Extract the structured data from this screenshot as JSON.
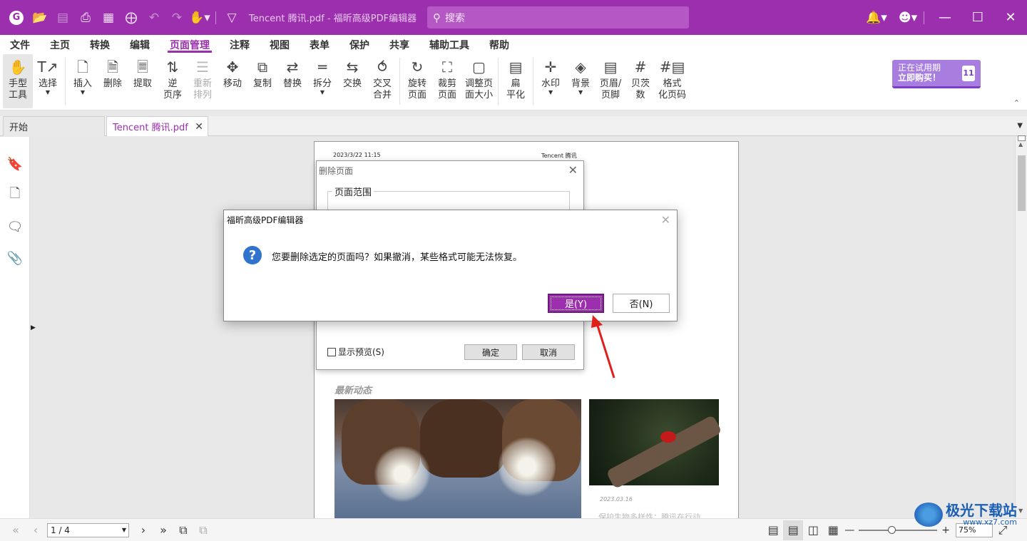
{
  "app": {
    "title": "Tencent 腾讯.pdf - 福昕高级PDF编辑器",
    "search_placeholder": "搜索",
    "accent_color": "#9b2fae"
  },
  "titlebar_icons": [
    "app-logo",
    "open-folder-icon",
    "save-icon",
    "print-icon",
    "export-icon",
    "new-file-icon",
    "undo-icon",
    "redo-icon",
    "hand-dropdown-icon",
    "customize-dropdown-icon"
  ],
  "menu": {
    "items": [
      "文件",
      "主页",
      "转换",
      "编辑",
      "页面管理",
      "注释",
      "视图",
      "表单",
      "保护",
      "共享",
      "辅助工具",
      "帮助"
    ],
    "active": "页面管理"
  },
  "ribbon": {
    "hand": "手型\n工具",
    "select": "选择",
    "insert": "插入",
    "delete": "删除",
    "extract": "提取",
    "reverse": "逆\n页序",
    "reorder": "重新\n排列",
    "move": "移动",
    "copy": "复制",
    "replace": "替换",
    "split": "拆分",
    "swap": "交换",
    "interleave": "交叉\n合并",
    "rotate": "旋转\n页面",
    "crop": "裁剪\n页面",
    "resize": "调整页\n面大小",
    "flatten": "扁\n平化",
    "watermark": "水印",
    "background": "背景",
    "header_footer": "页眉/\n页脚",
    "bates": "贝茨\n数",
    "format_page_num": "格式\n化页码"
  },
  "trial": {
    "line1": "正在试用期",
    "line2": "立即购买！",
    "days": "11"
  },
  "tabs": [
    {
      "label": "开始"
    },
    {
      "label": "Tencent 腾讯.pdf"
    }
  ],
  "document": {
    "date": "2023/3/22 11:15",
    "header": "Tencent 腾讯",
    "section": "最新动态",
    "news_date": "2023.03.16",
    "news_caption": "保护生物多样性：腾讯在行动"
  },
  "dialog_delete": {
    "title": "删除页面",
    "group_label": "页面范围",
    "preview_label": "显示预览(S)",
    "ok": "确定",
    "cancel": "取消"
  },
  "dialog_confirm": {
    "title": "福昕高级PDF编辑器",
    "message": "您要删除选定的页面吗？如果撤消，某些格式可能无法恢复。",
    "yes": "是(Y)",
    "no": "否(N)"
  },
  "statusbar": {
    "page": "1 / 4",
    "zoom": "75%",
    "zoom_fraction": 0.42
  },
  "watermark": {
    "name": "极光下载站",
    "url": "www.xz7.com"
  }
}
